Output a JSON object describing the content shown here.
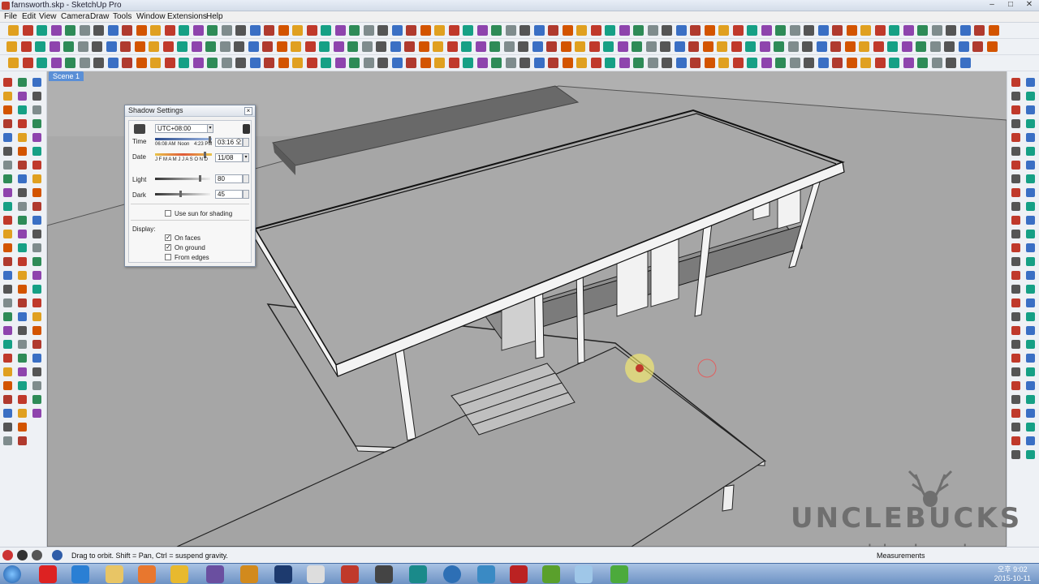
{
  "window": {
    "title": "farnsworth.skp - SketchUp Pro"
  },
  "menu": [
    "File",
    "Edit",
    "View",
    "Camera",
    "Draw",
    "Tools",
    "Window",
    "Extensions",
    "Help"
  ],
  "scene_tab": "Scene 1",
  "shadow_settings": {
    "title": "Shadow Settings",
    "timezone": "UTC+08:00",
    "time_label": "Time",
    "time_scale": [
      "06:08 AM",
      "Noon",
      "4:23 PM"
    ],
    "time_value": "03:16 오",
    "date_label": "Date",
    "month_scale": "J F M A M J J A S O N D",
    "date_value": "11/08",
    "light_label": "Light",
    "light_value": "80",
    "dark_label": "Dark",
    "dark_value": "45",
    "use_sun_label": "Use sun for shading",
    "display_label": "Display:",
    "on_faces": "On faces",
    "on_ground": "On ground",
    "from_edges": "From edges"
  },
  "status": {
    "message": "Drag to orbit. Shift = Pan, Ctrl = suspend gravity.",
    "measurements": "Measurements"
  },
  "watermark": {
    "name": "UNCLEBUCKS",
    "url": "www.unclebucks.co.kr"
  },
  "clock": {
    "time": "오후 9:02",
    "date": "2015-10-11"
  },
  "colors": {
    "viewport": "#a9a9a9",
    "accent": "#5a8fd6"
  }
}
